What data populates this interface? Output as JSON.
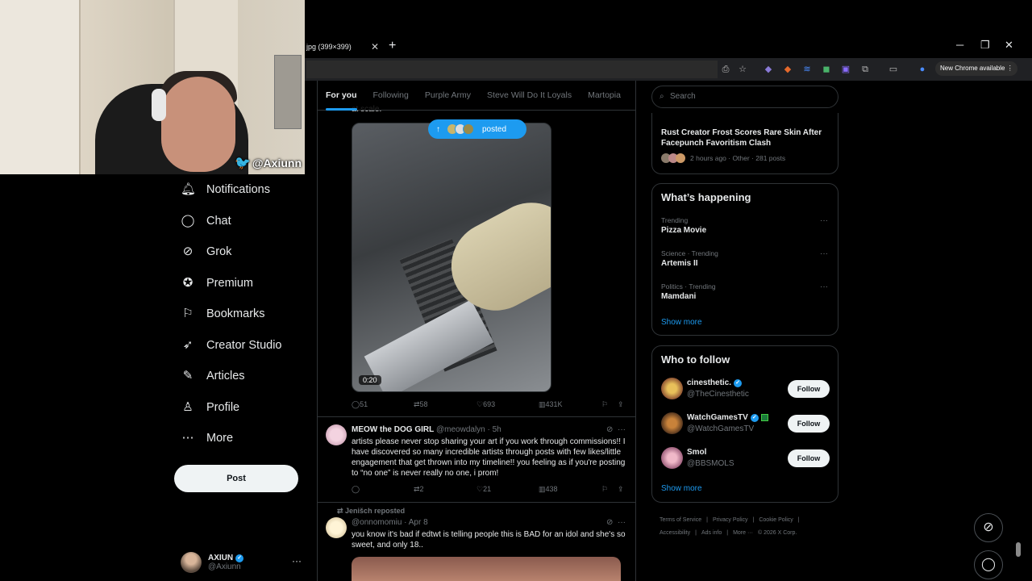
{
  "browser": {
    "tab_title": "jpg (399×399)",
    "tab_close": "✕",
    "new_tab": "+",
    "minimize": "─",
    "restore": "❐",
    "close": "✕",
    "chrome_available": "New Chrome available ⋮"
  },
  "webcam": {
    "handle": "@Axiunn"
  },
  "nav": {
    "items": [
      {
        "label": "Notifications",
        "icon": "bell-icon"
      },
      {
        "label": "Chat",
        "icon": "chat-icon"
      },
      {
        "label": "Grok",
        "icon": "grok-icon"
      },
      {
        "label": "Premium",
        "icon": "premium-icon"
      },
      {
        "label": "Bookmarks",
        "icon": "bookmark-icon"
      },
      {
        "label": "Creator Studio",
        "icon": "rocket-icon"
      },
      {
        "label": "Articles",
        "icon": "articles-icon"
      },
      {
        "label": "Profile",
        "icon": "profile-icon"
      },
      {
        "label": "More",
        "icon": "more-icon"
      }
    ],
    "post_label": "Post",
    "account": {
      "display_name": "AXIUN",
      "handle": "@Axiunn",
      "menu": "···"
    }
  },
  "timeline": {
    "tabs": [
      "For you",
      "Following",
      "Purple Army",
      "Steve Will Do It Loyals",
      "Martopia"
    ],
    "truncated_text": "at scale.",
    "posted_pill": "posted",
    "video_duration": "0:20",
    "tweet1_actions": {
      "replies": "51",
      "reposts": "58",
      "likes": "693",
      "views": "431K"
    },
    "tweet2": {
      "display_name": "MEOW the DOG GIRL",
      "meta": "@meowdalyn · 5h",
      "text": "artists please never stop sharing your art if you work through commissions!! I have discovered so many incredible artists through posts with few likes/little engagement that get thrown into my timeline!! you feeling as if you're posting to “no one” is never really no one, i prom!",
      "actions": {
        "replies": "",
        "reposts": "2",
        "likes": "21",
        "views": "438"
      }
    },
    "tweet3": {
      "repost_line": "Jenišch reposted",
      "meta": "@onnomomiu · Apr 8",
      "text": "you know it's bad if edtwt is telling people this is BAD for an idol and she's so sweet, and only 18.."
    }
  },
  "sidebar": {
    "search_placeholder": "Search",
    "news": {
      "title": "Rust Creator Frost Scores Rare Skin After Facepunch Favoritism Clash",
      "meta": "2 hours ago · Other · 281 posts"
    },
    "happening": {
      "title": "What’s happening",
      "trends": [
        {
          "category": "Trending",
          "name": "Pizza Movie"
        },
        {
          "category": "Science · Trending",
          "name": "Artemis II"
        },
        {
          "category": "Politics · Trending",
          "name": "Mamdani"
        }
      ],
      "show_more": "Show more"
    },
    "who_to_follow": {
      "title": "Who to follow",
      "accounts": [
        {
          "name": "cinesthetic.",
          "handle": "@TheCinesthetic",
          "button": "Follow"
        },
        {
          "name": "WatchGamesTV",
          "handle": "@WatchGamesTV",
          "button": "Follow"
        },
        {
          "name": "Smol    ",
          "handle": "@BBSMOLS",
          "button": "Follow"
        }
      ],
      "show_more": "Show more"
    },
    "footer": [
      "Terms of Service",
      "|",
      "Privacy Policy",
      "|",
      "Cookie Policy",
      "|",
      "Accessibility",
      "|",
      "Ads info",
      "|",
      "More ···",
      "© 2026 X Corp."
    ]
  },
  "colors": {
    "accent": "#1d9bf0",
    "background": "#000000",
    "muted": "#71767b"
  }
}
